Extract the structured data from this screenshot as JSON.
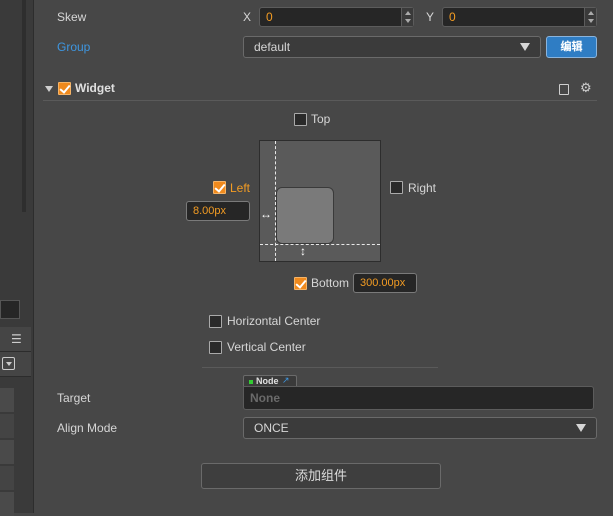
{
  "skew": {
    "label": "Skew",
    "x_label": "X",
    "x_value": "0",
    "y_label": "Y",
    "y_value": "0"
  },
  "group": {
    "label": "Group",
    "value": "default",
    "edit_button": "编辑"
  },
  "widget": {
    "title": "Widget",
    "enabled": true,
    "top": {
      "label": "Top",
      "checked": false
    },
    "left": {
      "label": "Left",
      "checked": true,
      "value": "8.00px"
    },
    "right": {
      "label": "Right",
      "checked": false
    },
    "bottom": {
      "label": "Bottom",
      "checked": true,
      "value": "300.00px"
    },
    "horizontal_center": {
      "label": "Horizontal Center",
      "checked": false
    },
    "vertical_center": {
      "label": "Vertical Center",
      "checked": false
    },
    "target": {
      "label": "Target",
      "badge": "Node",
      "value": "None"
    },
    "align_mode": {
      "label": "Align Mode",
      "value": "ONCE"
    }
  },
  "add_component_button": "添加组件",
  "colors": {
    "accent_orange": "#f39c23",
    "link_blue": "#3e96e0",
    "button_blue": "#2f7dc4",
    "panel_bg": "#474747"
  },
  "icons": [
    "book-icon",
    "gear-icon",
    "chevron-down-icon",
    "external-link-icon"
  ]
}
